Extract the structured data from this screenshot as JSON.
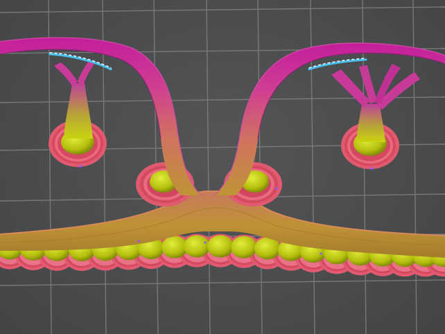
{
  "view": {
    "type": "slicer-preview",
    "background_color": "#4b4c4e",
    "grid_color": "#7d7e80",
    "colors": {
      "outer_wall": "#e25a6f",
      "wall_highlight": "#f2a0ac",
      "support_fill": "#c9d40f",
      "support_fill_dark": "#8f9a0a",
      "infill_gradient_bottom": "#b98f3c",
      "infill_gradient_mid": "#cf5c7a",
      "infill_gradient_top": "#c3229f",
      "travel_moves": "#39c1e6",
      "retraction_marks": "#8a5cff"
    },
    "objects": [
      {
        "name": "bridge-arch-left",
        "kind": "arch"
      },
      {
        "name": "bridge-arch-right",
        "kind": "arch"
      },
      {
        "name": "base-beam",
        "kind": "beam"
      },
      {
        "name": "tree-support-left",
        "kind": "support"
      },
      {
        "name": "tree-support-right",
        "kind": "support"
      },
      {
        "name": "support-foot-center-left",
        "kind": "support"
      },
      {
        "name": "support-foot-center-right",
        "kind": "support"
      }
    ]
  }
}
